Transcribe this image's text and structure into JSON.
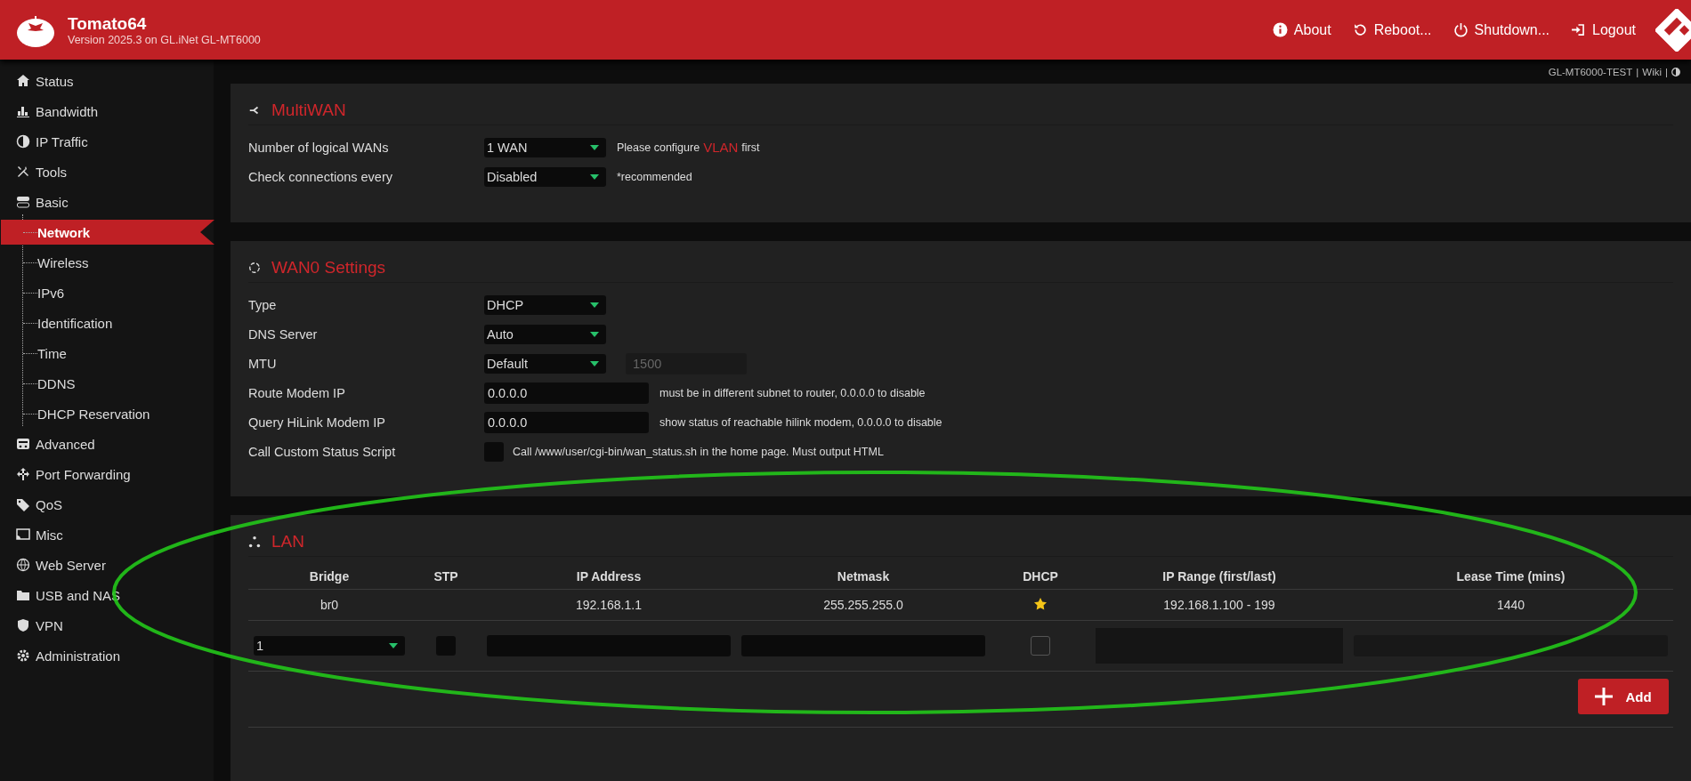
{
  "header": {
    "title": "Tomato64",
    "subtitle": "Version 2025.3 on GL.iNet GL-MT6000",
    "actions": [
      "About",
      "Reboot...",
      "Shutdown...",
      "Logout"
    ]
  },
  "topbar": {
    "hostname": "GL-MT6000-TEST",
    "separator_1": "|",
    "wiki": "Wiki",
    "separator_2": "|"
  },
  "sidebar": {
    "items": [
      {
        "label": "Status",
        "selected": false
      },
      {
        "label": "Bandwidth",
        "selected": false
      },
      {
        "label": "IP Traffic",
        "selected": false
      },
      {
        "label": "Tools",
        "selected": false
      },
      {
        "label": "Basic",
        "selected": false,
        "children": [
          {
            "label": "Network",
            "selected": true
          },
          {
            "label": "Wireless",
            "selected": false
          },
          {
            "label": "IPv6",
            "selected": false
          },
          {
            "label": "Identification",
            "selected": false
          },
          {
            "label": "Time",
            "selected": false
          },
          {
            "label": "DDNS",
            "selected": false
          },
          {
            "label": "DHCP Reservation",
            "selected": false
          }
        ]
      },
      {
        "label": "Advanced",
        "selected": false
      },
      {
        "label": "Port Forwarding",
        "selected": false
      },
      {
        "label": "QoS",
        "selected": false
      },
      {
        "label": "Misc",
        "selected": false
      },
      {
        "label": "Web Server",
        "selected": false
      },
      {
        "label": "USB and NAS",
        "selected": false
      },
      {
        "label": "VPN",
        "selected": false
      },
      {
        "label": "Administration",
        "selected": false
      }
    ]
  },
  "multiwan": {
    "title": "MultiWAN",
    "rows": [
      {
        "label": "Number of logical WANs",
        "kind": "select",
        "value": "1 WAN",
        "note": "Please configure",
        "link": "VLAN",
        "note_after": "first"
      },
      {
        "label": "Check connections every",
        "kind": "select",
        "value": "Disabled",
        "note": "*recommended"
      }
    ]
  },
  "wan0": {
    "title": "WAN0 Settings",
    "rows": [
      {
        "label": "Type",
        "kind": "select",
        "value": "DHCP"
      },
      {
        "label": "DNS Server",
        "kind": "select",
        "value": "Auto"
      },
      {
        "label": "MTU",
        "kind": "select",
        "value": "Default",
        "extra": {
          "value": "1500",
          "disabled": true
        }
      },
      {
        "label": "Route Modem IP",
        "kind": "text",
        "value": "0.0.0.0",
        "note": "must be in different subnet to router, 0.0.0.0 to disable"
      },
      {
        "label": "Query HiLink Modem IP",
        "kind": "text",
        "value": "0.0.0.0",
        "note": "show status of reachable hilink modem, 0.0.0.0 to disable"
      },
      {
        "label": "Call Custom Status Script",
        "kind": "checkbox",
        "checked": false,
        "note": "Call /www/user/cgi-bin/wan_status.sh in the home page. Must output HTML"
      }
    ]
  },
  "lan": {
    "title": "LAN",
    "columns": [
      "Bridge",
      "STP",
      "IP Address",
      "Netmask",
      "DHCP",
      "IP Range (first/last)",
      "Lease Time (mins)"
    ],
    "rows": [
      {
        "bridge": "br0",
        "ip": "192.168.1.1",
        "netmask": "255.255.255.0",
        "dhcp": true,
        "ip_range": "192.168.1.100 - 199",
        "lease": "1440"
      }
    ],
    "new_row": {
      "bridge": "1",
      "stp_checked": false,
      "dhcp_checked": false
    },
    "add_button": "Add"
  }
}
